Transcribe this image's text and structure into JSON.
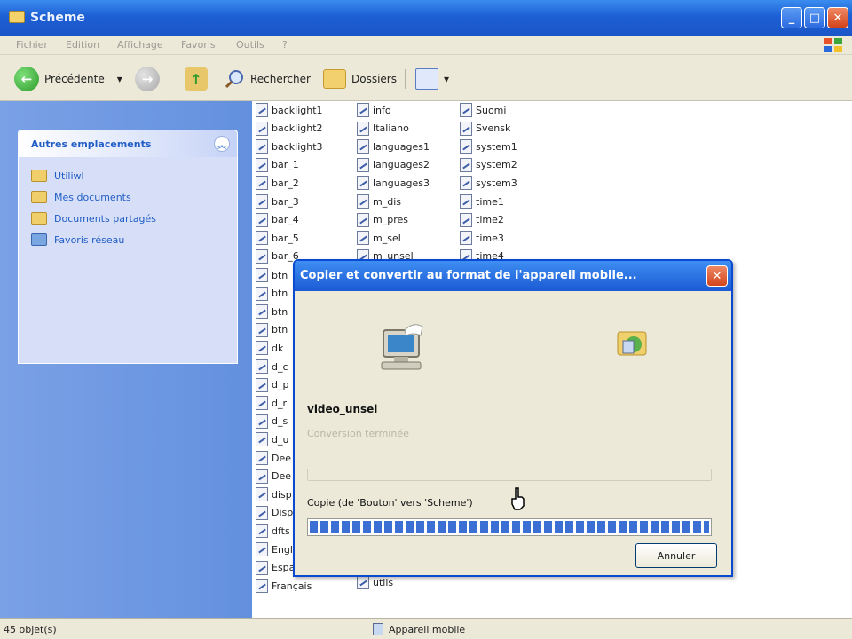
{
  "window": {
    "title": "Scheme",
    "min": "_",
    "max": "□",
    "close": "✕"
  },
  "menu": [
    "Fichier",
    "Edition",
    "Affichage",
    "Favoris",
    "Outils",
    "?"
  ],
  "toolbar": {
    "back": "Précédente",
    "back_arrow": "▾",
    "search": "Rechercher",
    "folders": "Dossiers",
    "views_arrow": "▾"
  },
  "left_panel": {
    "title": "Autres emplacements",
    "items": [
      "Utiliwl",
      "Mes documents",
      "Documents partagés",
      "Favoris réseau"
    ]
  },
  "files": {
    "col1": [
      "backlight1",
      "backlight2",
      "backlight3",
      "bar_1",
      "bar_2",
      "bar_3",
      "bar_4",
      "bar_5",
      "bar_6"
    ],
    "col2": [
      "info",
      "Italiano",
      "languages1",
      "languages2",
      "languages3",
      "m_dis",
      "m_pres",
      "m_sel",
      "m_unsel"
    ],
    "col3": [
      "Suomi",
      "Svensk",
      "system1",
      "system2",
      "system3",
      "time1",
      "time2",
      "time3",
      "time4"
    ],
    "col1_lower": [
      "btn",
      "btn",
      "btn",
      "btn",
      "dk",
      "d_c",
      "d_p",
      "d_r",
      "d_s",
      "d_u",
      "Dee",
      "Dee",
      "disp",
      "Disp",
      "dfts",
      "Engl",
      "Espa",
      "Français"
    ],
    "col2_lower": [
      "utils"
    ]
  },
  "status": {
    "left": "45 objet(s)",
    "right": "Appareil mobile"
  },
  "dialog": {
    "title": "Copier et convertir au format de l'appareil mobile...",
    "close": "✕",
    "filename": "video_unsel",
    "subtitle": "Conversion terminée",
    "copy_text": "Copie (de 'Bouton' vers 'Scheme')",
    "progress": 1.0,
    "cancel": "Annuler"
  }
}
